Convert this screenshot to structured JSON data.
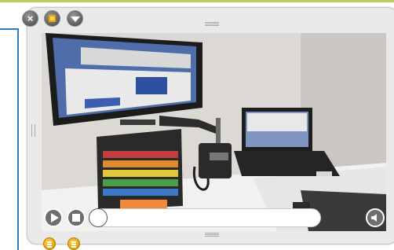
{
  "window": {
    "close_icon": "close-icon",
    "restore_icon": "restore-window-icon",
    "collapse_icon": "chevron-down-icon"
  },
  "video": {
    "scene": "desk-setup-video-frame",
    "progress_fraction": 0.0
  },
  "controls": {
    "play_icon": "play-icon",
    "stop_icon": "stop-icon",
    "volume_icon": "volume-icon"
  },
  "footer": {
    "buttons": [
      "caption-icon",
      "caption-icon"
    ]
  },
  "colors": {
    "accent_green": "#b9cf55",
    "frame_blue": "#2e7bbf",
    "control_gray": "#6e6e6e",
    "caption_gold": "#f2b400"
  }
}
